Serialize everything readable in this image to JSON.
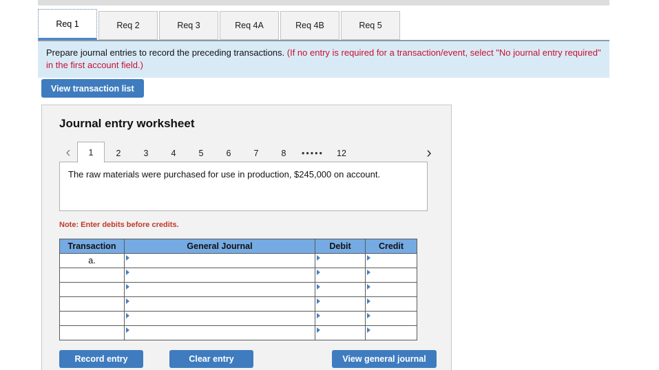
{
  "tabs": [
    {
      "label": "Req 1",
      "active": true
    },
    {
      "label": "Req 2",
      "active": false
    },
    {
      "label": "Req 3",
      "active": false
    },
    {
      "label": "Req 4A",
      "active": false
    },
    {
      "label": "Req 4B",
      "active": false
    },
    {
      "label": "Req 5",
      "active": false
    }
  ],
  "banner": {
    "black_text": "Prepare journal entries to record the preceding transactions.",
    "red_text": "(If no entry is required for a transaction/event, select \"No journal entry required\" in the first account field.)"
  },
  "toolbar": {
    "view_transaction_list_label": "View transaction list"
  },
  "worksheet": {
    "title": "Journal entry worksheet",
    "pager": {
      "prev_icon": "chevron-left-icon",
      "next_icon": "chevron-right-icon",
      "pages": [
        "1",
        "2",
        "3",
        "4",
        "5",
        "6",
        "7",
        "8"
      ],
      "ellipsis": "•••••",
      "last_page": "12",
      "active_page": "1"
    },
    "description": "The raw materials were purchased for use in production, $245,000 on account.",
    "note": "Note: Enter debits before credits.",
    "table": {
      "headers": [
        "Transaction",
        "General Journal",
        "Debit",
        "Credit"
      ],
      "rows": [
        {
          "transaction": "a.",
          "general_journal": "",
          "debit": "",
          "credit": ""
        },
        {
          "transaction": "",
          "general_journal": "",
          "debit": "",
          "credit": ""
        },
        {
          "transaction": "",
          "general_journal": "",
          "debit": "",
          "credit": ""
        },
        {
          "transaction": "",
          "general_journal": "",
          "debit": "",
          "credit": ""
        },
        {
          "transaction": "",
          "general_journal": "",
          "debit": "",
          "credit": ""
        },
        {
          "transaction": "",
          "general_journal": "",
          "debit": "",
          "credit": ""
        }
      ]
    },
    "footer": {
      "record_entry_label": "Record entry",
      "clear_entry_label": "Clear entry",
      "view_general_journal_label": "View general journal"
    }
  },
  "colors": {
    "header_blue": "#75aae2",
    "button_blue": "#3f7cbf",
    "banner_bg": "#d9eaf7",
    "note_red": "#c0392b",
    "banner_red": "#c8102e"
  }
}
